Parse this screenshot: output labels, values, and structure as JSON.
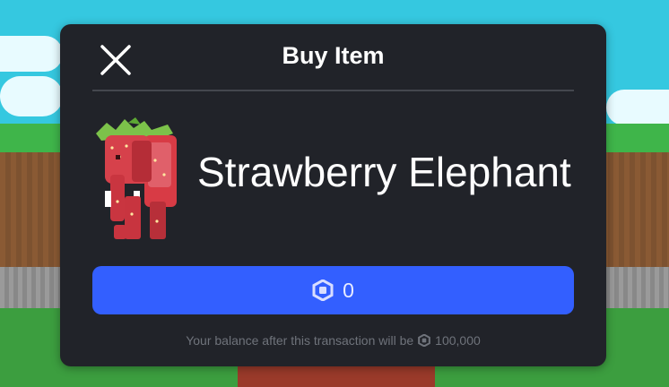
{
  "dialog": {
    "title": "Buy Item",
    "close_icon": "close-icon"
  },
  "item": {
    "name": "Strawberry Elephant",
    "image": "strawberry-elephant-image"
  },
  "buy_button": {
    "currency_icon": "robux-icon",
    "price": "0"
  },
  "balance": {
    "text": "Your balance after this transaction will be",
    "currency_icon": "robux-icon",
    "amount": "100,000"
  },
  "colors": {
    "modal_bg": "#212329",
    "buy_button": "#335fff",
    "sky": "#35c8e0",
    "grass": "#3fb54a"
  }
}
